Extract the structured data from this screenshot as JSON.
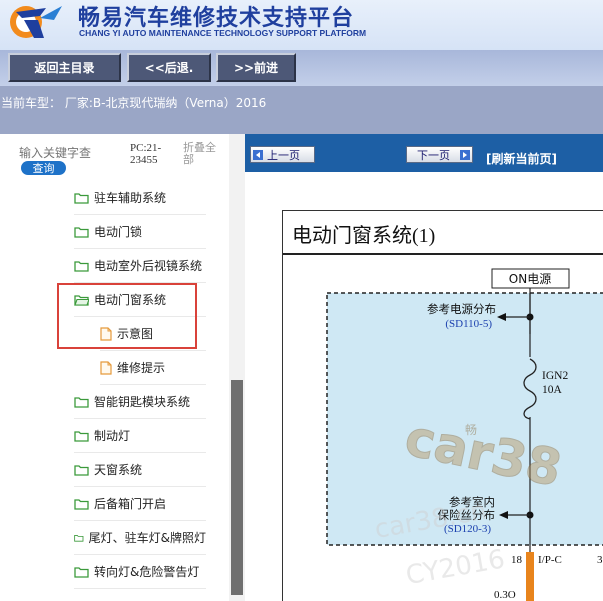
{
  "header": {
    "title_cn": "畅易汽车维修技术支持平台",
    "title_en": "CHANG YI AUTO MAINTENANCE TECHNOLOGY SUPPORT PLATFORM"
  },
  "toolbar": {
    "home_label": "返回主目录",
    "back_label": "<<后退.",
    "forward_label": ">>前进"
  },
  "car": {
    "current_model": "当前车型：  厂家:B-北京现代瑞纳（Verna）2016"
  },
  "search": {
    "placeholder": "输入关键字查",
    "button_label": "查询",
    "pc_label": "PC:21-23455",
    "fold_label": "折叠全部"
  },
  "tree": {
    "items": [
      {
        "label": "驻车辅助系统",
        "type": "folder"
      },
      {
        "label": "电动门锁",
        "type": "folder"
      },
      {
        "label": "电动室外后视镜系统",
        "type": "folder"
      },
      {
        "label": "电动门窗系统",
        "type": "folder-open"
      },
      {
        "label": "示意图",
        "type": "file"
      },
      {
        "label": "维修提示",
        "type": "file"
      },
      {
        "label": "智能钥匙模块系统",
        "type": "folder"
      },
      {
        "label": "制动灯",
        "type": "folder"
      },
      {
        "label": "天窗系统",
        "type": "folder"
      },
      {
        "label": "后备箱门开启",
        "type": "folder"
      },
      {
        "label": "尾灯、驻车灯&牌照灯",
        "type": "folder"
      },
      {
        "label": "转向灯&危险警告灯",
        "type": "folder"
      }
    ]
  },
  "nav": {
    "prev_label": "上一页",
    "next_label": "下一页",
    "refresh_label": "[刷新当前页]"
  },
  "document": {
    "title": "电动门窗系统(1)",
    "on_power": "ON电源",
    "ref_power": "参考电源分布",
    "ref_power_code": "(SD110-5)",
    "fuse_name": "IGN2",
    "fuse_rating": "10A",
    "ref_fuse_line1": "参考室内",
    "ref_fuse_line2": "保险丝分布",
    "ref_fuse_code": "(SD120-3)",
    "pin_number": "18",
    "connector": "I/P-C",
    "pin_right": "3",
    "wire_label": "0.3O",
    "watermark1": "car38",
    "watermark2": "car38.cn",
    "watermark3": "CY2016",
    "watermark_small": "畅"
  },
  "colors": {
    "header_blue": "#1f3f9e",
    "nav_blue": "#1d5fa5",
    "highlight_red": "#d9423a",
    "diagram_fill": "#cfe8f4",
    "wire_orange": "#e8841c",
    "ref_code_blue": "#1a3fae"
  }
}
